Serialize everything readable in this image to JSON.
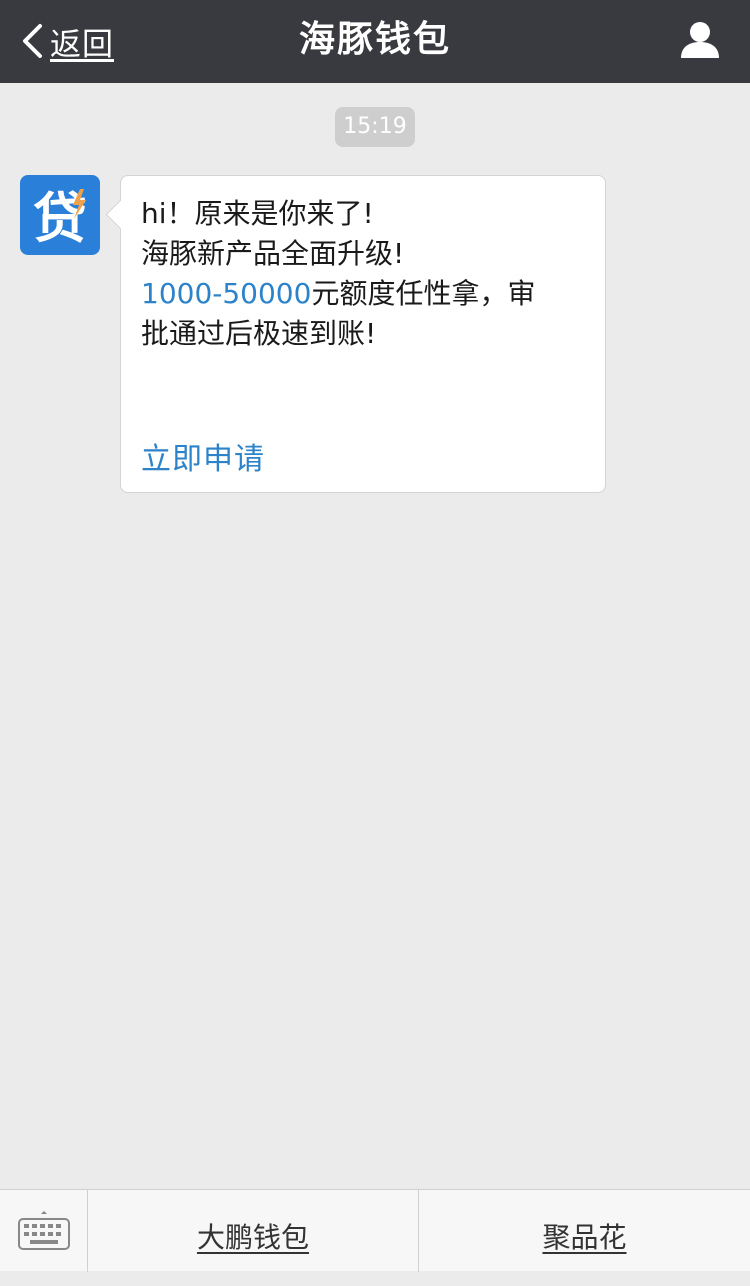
{
  "header": {
    "back_label": "返回",
    "title": "海豚钱包",
    "back_icon": "chevron-left-icon",
    "profile_icon": "user-icon"
  },
  "chat": {
    "timestamp": "15:19",
    "avatar_char": "贷",
    "message": {
      "line1": "hi！原来是你来了!",
      "line2": "海豚新产品全面升级!",
      "amount": "1000-50000",
      "line3_rest": "元额度任性拿，审",
      "line4": "批通过后极速到账!",
      "link": "立即申请"
    }
  },
  "bottom_menu": {
    "keyboard_icon": "keyboard-icon",
    "items": [
      {
        "label": "大鹏钱包"
      },
      {
        "label": "聚品花"
      }
    ]
  },
  "colors": {
    "navbar_bg": "#393a3f",
    "chat_bg": "#ebebeb",
    "link": "#2d83c9",
    "avatar_bg": "#2a7fd8"
  }
}
